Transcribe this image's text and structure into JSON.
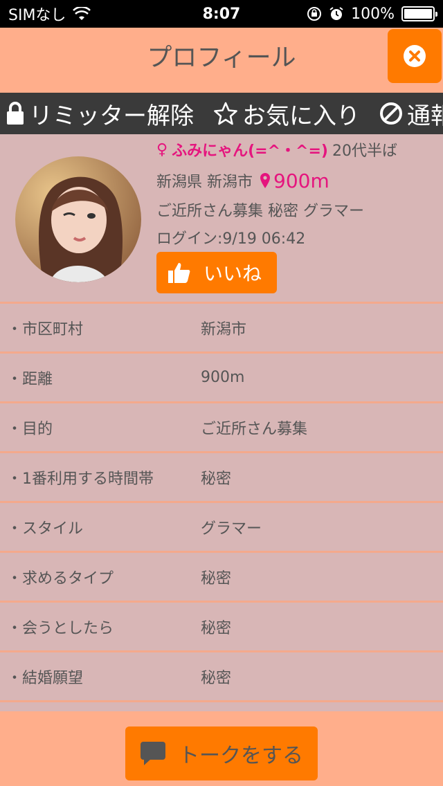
{
  "status_bar": {
    "carrier": "SIMなし",
    "time": "8:07",
    "battery": "100%"
  },
  "header": {
    "title": "プロフィール"
  },
  "actions": [
    {
      "label": "リミッター解除",
      "icon": "lock-icon"
    },
    {
      "label": "お気に入り",
      "icon": "star-icon"
    },
    {
      "label": "通報",
      "icon": "prohibited-icon"
    }
  ],
  "profile": {
    "gender_symbol": "♀",
    "name": "ふみにゃん(=^・^=)",
    "age": "20代半ば",
    "location": "新潟県 新潟市",
    "distance": "900m",
    "tags": "ご近所さん募集  秘密  グラマー",
    "login": "ログイン:9/19 06:42",
    "like_label": "いいね"
  },
  "details": [
    {
      "label": "・市区町村",
      "value": "新潟市"
    },
    {
      "label": "・距離",
      "value": "900m"
    },
    {
      "label": "・目的",
      "value": "ご近所さん募集"
    },
    {
      "label": "・1番利用する時間帯",
      "value": "秘密"
    },
    {
      "label": "・スタイル",
      "value": "グラマー"
    },
    {
      "label": "・求めるタイプ",
      "value": "秘密"
    },
    {
      "label": "・会うとしたら",
      "value": "秘密"
    },
    {
      "label": "・結婚願望",
      "value": "秘密"
    }
  ],
  "footer": {
    "talk_label": "トークをする"
  },
  "colors": {
    "header_bg": "#ffae8b",
    "accent_orange": "#ff7a00",
    "content_bg": "#d8b6b6",
    "name_pink": "#e5157e",
    "action_bar_bg": "#3a3a3a"
  }
}
